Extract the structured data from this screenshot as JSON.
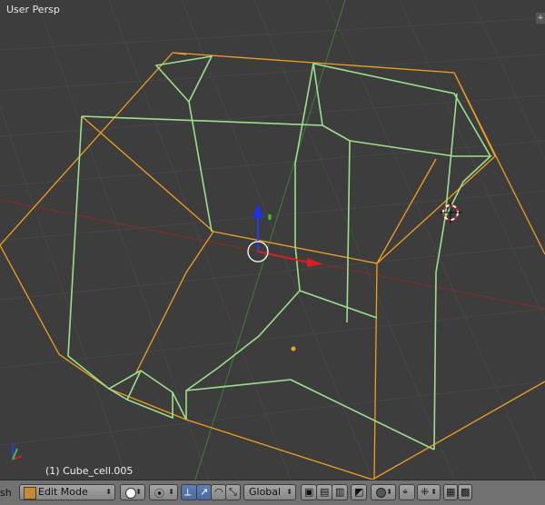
{
  "viewport": {
    "title": "User Persp",
    "active_object": "(1) Cube_cell.005",
    "corner_widget": "+"
  },
  "header": {
    "editor_label_fragment": "sh",
    "mode": "Edit Mode",
    "orientation": "Global"
  },
  "colors": {
    "background": "#3d3d3d",
    "grid": "#474747",
    "x_axis": "#8a2b2b",
    "y_axis": "#3f7f2f",
    "selected_edges": "#f0a020",
    "mesh_edges": "#9be08a",
    "header": "#727272"
  },
  "icons": [
    "3d-cursor-icon",
    "manipulator-icon",
    "origin-dot",
    "axis-gizmo-icon",
    "viewport-shading-icon",
    "pivot-icon",
    "translate-icon",
    "rotate-icon",
    "scale-icon",
    "vertex-select-icon",
    "edge-select-icon",
    "face-select-icon",
    "proportional-edit-icon",
    "snap-icon",
    "render-icon",
    "camera-icon"
  ]
}
